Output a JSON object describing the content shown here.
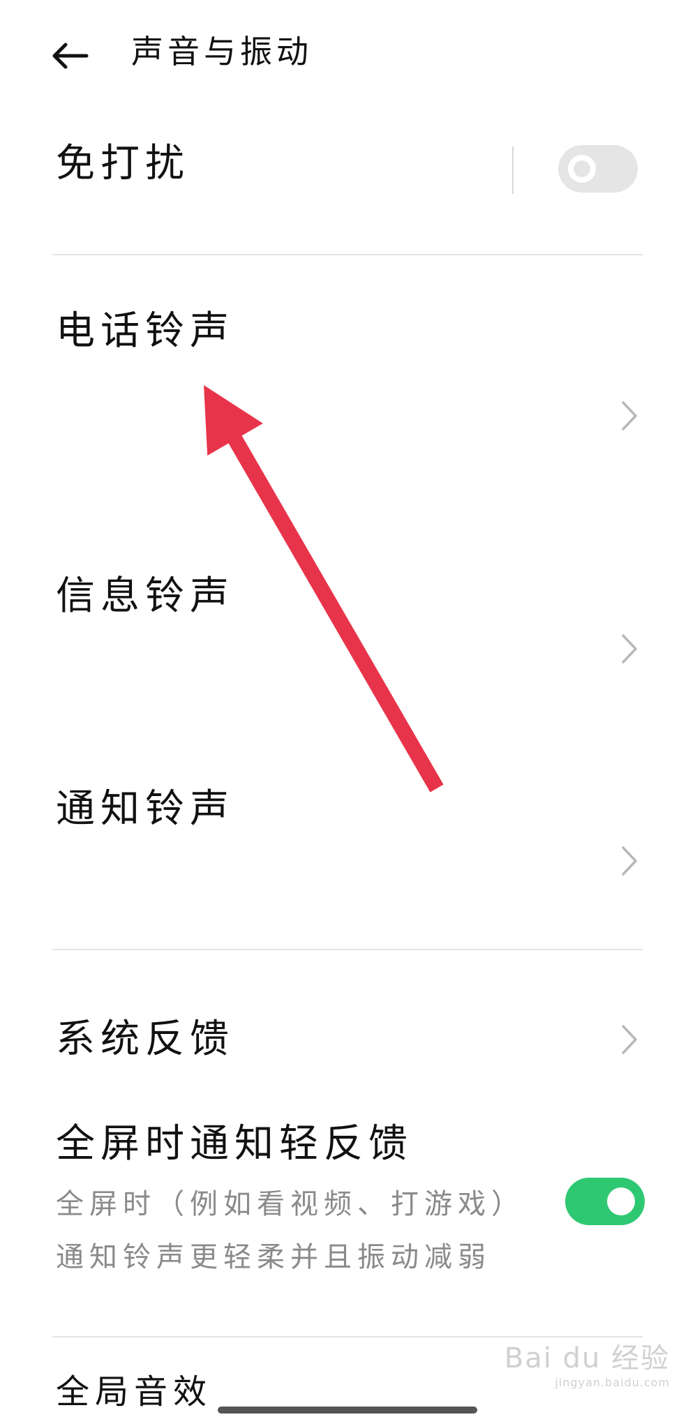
{
  "header": {
    "back_icon": "arrow-left-icon",
    "title": "声音与振动"
  },
  "do_not_disturb": {
    "label": "免打扰",
    "enabled": false
  },
  "ringtones": {
    "call": {
      "label": "电话铃声"
    },
    "message": {
      "label": "信息铃声"
    },
    "notification": {
      "label": "通知铃声"
    }
  },
  "system_feedback": {
    "label": "系统反馈"
  },
  "fullscreen_feedback": {
    "label": "全屏时通知轻反馈",
    "description_line1": "全屏时（例如看视频、打游戏）",
    "description_line2": "通知铃声更轻柔并且振动减弱",
    "enabled": true
  },
  "global_sound_effect": {
    "label": "全局音效"
  },
  "annotation": {
    "arrow_color": "#e8344a"
  },
  "watermark": {
    "text": "Bai du 经验",
    "sub": "jingyan.baidu.com"
  },
  "colors": {
    "toggle_on": "#2fc872",
    "toggle_off": "#e5e5e5",
    "chevron": "#b8b8b8"
  }
}
